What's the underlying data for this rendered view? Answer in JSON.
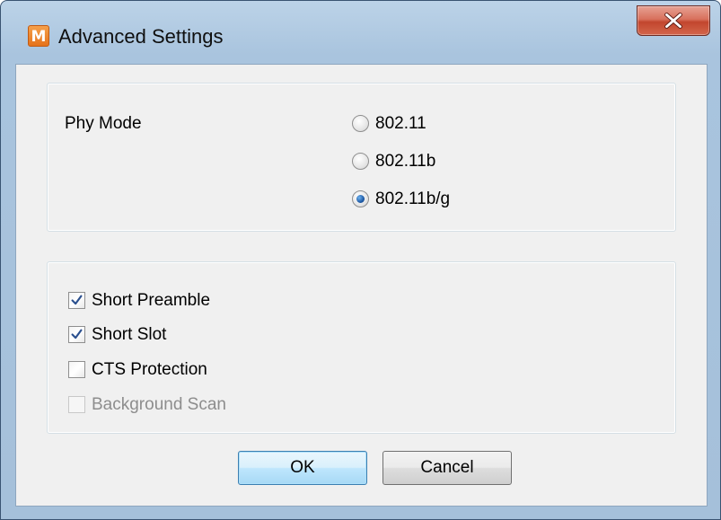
{
  "window": {
    "title": "Advanced Settings",
    "app_icon_letter": "M"
  },
  "phy_mode": {
    "label": "Phy Mode",
    "options": [
      {
        "label": "802.11",
        "selected": false
      },
      {
        "label": "802.11b",
        "selected": false
      },
      {
        "label": "802.11b/g",
        "selected": true
      }
    ]
  },
  "options": {
    "items": [
      {
        "label": "Short Preamble",
        "checked": true,
        "enabled": true
      },
      {
        "label": "Short Slot",
        "checked": true,
        "enabled": true
      },
      {
        "label": "CTS Protection",
        "checked": false,
        "enabled": true
      },
      {
        "label": "Background Scan",
        "checked": false,
        "enabled": false
      }
    ]
  },
  "buttons": {
    "ok_label": "OK",
    "cancel_label": "Cancel"
  },
  "colors": {
    "window_frame": "#a9c4de",
    "client_bg": "#f0f0f0",
    "close_button": "#c2462e",
    "default_button_border": "#3c7fb1"
  }
}
